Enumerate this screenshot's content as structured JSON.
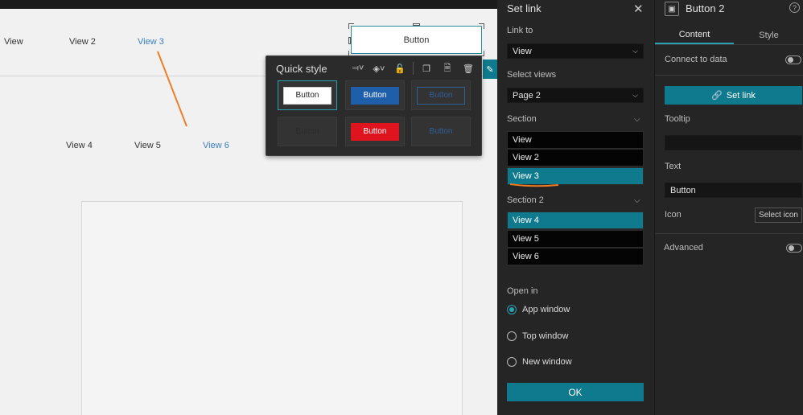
{
  "canvas": {
    "views_row1": [
      "View",
      "View 2",
      "View 3"
    ],
    "views_row2": [
      "View 4",
      "View 5",
      "View 6"
    ],
    "selected_button_label": "Button"
  },
  "quick_style": {
    "title": "Quick style",
    "cells": [
      {
        "label": "Button",
        "bg": "#ffffff",
        "fg": "#222222",
        "border": "#cccccc",
        "selected": true
      },
      {
        "label": "Button",
        "bg": "#1f5ea8",
        "fg": "#ffffff",
        "border": "#1f5ea8",
        "selected": false
      },
      {
        "label": "Button",
        "bg": "transparent",
        "fg": "#2f5f99",
        "border": "#2f5f99",
        "selected": false
      },
      {
        "label": "Button",
        "bg": "#333333",
        "fg": "#2a2a2a",
        "border": "#333333",
        "selected": false
      },
      {
        "label": "Button",
        "bg": "#e0141f",
        "fg": "#ffffff",
        "border": "#e0141f",
        "selected": false
      },
      {
        "label": "Button",
        "bg": "transparent",
        "fg": "#2f5f99",
        "border": "transparent",
        "selected": false
      }
    ]
  },
  "set_link": {
    "title": "Set link",
    "link_to_label": "Link to",
    "link_to_value": "View",
    "select_views_label": "Select views",
    "select_views_value": "Page 2",
    "section_label": "Section",
    "section_items": [
      {
        "label": "View",
        "active": false
      },
      {
        "label": "View 2",
        "active": false
      },
      {
        "label": "View 3",
        "active": true
      }
    ],
    "section2_label": "Section 2",
    "section2_items": [
      {
        "label": "View 4",
        "active": true
      },
      {
        "label": "View 5",
        "active": false
      },
      {
        "label": "View 6",
        "active": false
      }
    ],
    "open_in_label": "Open in",
    "open_in_options": [
      {
        "label": "App window",
        "checked": true
      },
      {
        "label": "Top window",
        "checked": false
      },
      {
        "label": "New window",
        "checked": false
      }
    ],
    "ok_label": "OK"
  },
  "properties": {
    "title": "Button 2",
    "tab_content": "Content",
    "tab_style": "Style",
    "connect_to_data": "Connect to data",
    "set_link_button": "Set link",
    "tooltip_label": "Tooltip",
    "tooltip_value": "",
    "text_label": "Text",
    "text_value": "Button",
    "icon_label": "Icon",
    "select_icon_button": "Select icon",
    "advanced_label": "Advanced"
  },
  "colors": {
    "accent": "#0f7a8d",
    "annotation": "#f07e26"
  }
}
